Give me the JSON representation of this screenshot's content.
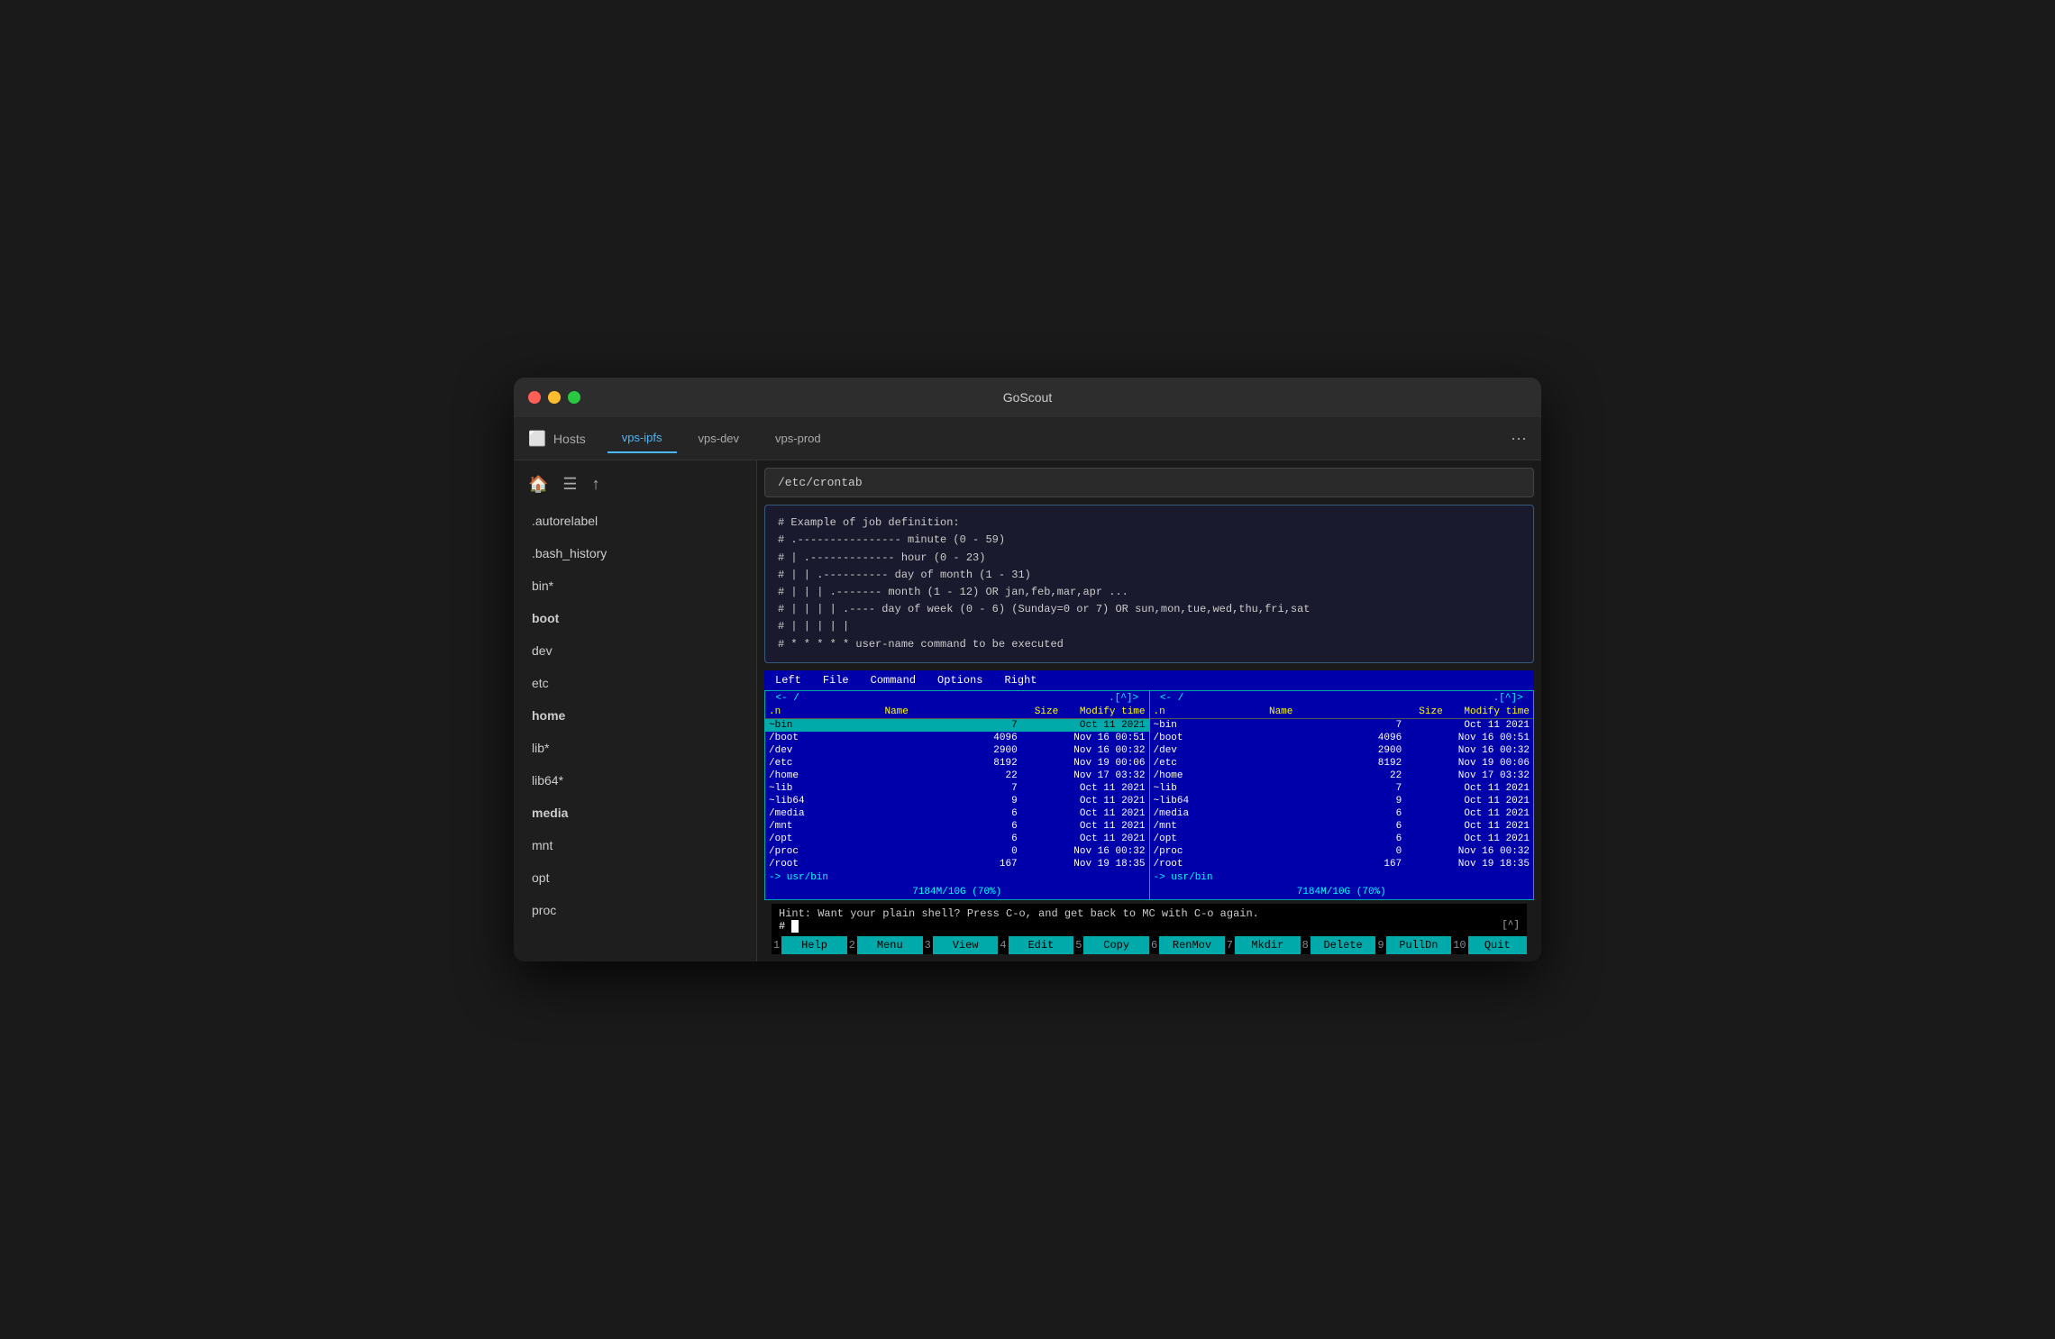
{
  "window": {
    "title": "GoScout"
  },
  "titlebar": {
    "title": "GoScout"
  },
  "tabs": {
    "hosts_label": "Hosts",
    "active_tab": "vps-ipfs",
    "items": [
      {
        "label": "vps-ipfs",
        "active": true
      },
      {
        "label": "vps-dev",
        "active": false
      },
      {
        "label": "vps-prod",
        "active": false
      }
    ]
  },
  "sidebar": {
    "items": [
      {
        "label": ".autorelabel",
        "bold": false
      },
      {
        "label": ".bash_history",
        "bold": false
      },
      {
        "label": "bin*",
        "bold": false
      },
      {
        "label": "boot",
        "bold": true
      },
      {
        "label": "dev",
        "bold": false
      },
      {
        "label": "etc",
        "bold": false
      },
      {
        "label": "home",
        "bold": true
      },
      {
        "label": "lib*",
        "bold": false
      },
      {
        "label": "lib64*",
        "bold": false
      },
      {
        "label": "media",
        "bold": true
      },
      {
        "label": "mnt",
        "bold": false
      },
      {
        "label": "opt",
        "bold": false
      },
      {
        "label": "proc",
        "bold": false
      }
    ]
  },
  "path_bar": {
    "value": "/etc/crontab"
  },
  "file_preview": {
    "lines": [
      "# Example of job definition:",
      "# .---------------- minute (0 - 59)",
      "# |  .------------- hour (0 - 23)",
      "# |  |  .---------- day of month (1 - 31)",
      "# |  |  |  .------- month (1 - 12) OR jan,feb,mar,apr ...",
      "# |  |  |  |  .---- day of week (0 - 6) (Sunday=0 or 7) OR sun,mon,tue,wed,thu,fri,sat",
      "# |  |  |  |  |",
      "# *  *  *  *  * user-name  command to be executed"
    ]
  },
  "mc": {
    "menubar": [
      "Left",
      "File",
      "Command",
      "Options",
      "Right"
    ],
    "left_panel": {
      "header": "<- /",
      "right_indicator": ".[^]>",
      "cols": [
        ".n",
        "Name",
        "Size",
        "Modify time"
      ],
      "files": [
        {
          "name": "~bin",
          "size": "7",
          "date": "Oct 11  2021",
          "selected": true
        },
        {
          "name": "/boot",
          "size": "4096",
          "date": "Nov 16 00:51"
        },
        {
          "name": "/dev",
          "size": "2900",
          "date": "Nov 16 00:32"
        },
        {
          "name": "/etc",
          "size": "8192",
          "date": "Nov 19 00:06"
        },
        {
          "name": "/home",
          "size": "22",
          "date": "Nov 17 03:32"
        },
        {
          "name": "~lib",
          "size": "7",
          "date": "Oct 11  2021"
        },
        {
          "name": "~lib64",
          "size": "9",
          "date": "Oct 11  2021"
        },
        {
          "name": "/media",
          "size": "6",
          "date": "Oct 11  2021"
        },
        {
          "name": "/mnt",
          "size": "6",
          "date": "Oct 11  2021"
        },
        {
          "name": "/opt",
          "size": "6",
          "date": "Oct 11  2021"
        },
        {
          "name": "/proc",
          "size": "0",
          "date": "Nov 16 00:32"
        },
        {
          "name": "/root",
          "size": "167",
          "date": "Nov 19 18:35"
        }
      ],
      "symlink": "-> usr/bin",
      "footer": "7184M/10G (70%)"
    },
    "right_panel": {
      "header": "<- /",
      "right_indicator": ".[^]>",
      "cols": [
        ".n",
        "Name",
        "Size",
        "Modify time"
      ],
      "files": [
        {
          "name": "~bin",
          "size": "7",
          "date": "Oct 11  2021"
        },
        {
          "name": "/boot",
          "size": "4096",
          "date": "Nov 16 00:51"
        },
        {
          "name": "/dev",
          "size": "2900",
          "date": "Nov 16 00:32"
        },
        {
          "name": "/etc",
          "size": "8192",
          "date": "Nov 19 00:06"
        },
        {
          "name": "/home",
          "size": "22",
          "date": "Nov 17 03:32"
        },
        {
          "name": "~lib",
          "size": "7",
          "date": "Oct 11  2021"
        },
        {
          "name": "~lib64",
          "size": "9",
          "date": "Oct 11  2021"
        },
        {
          "name": "/media",
          "size": "6",
          "date": "Oct 11  2021"
        },
        {
          "name": "/mnt",
          "size": "6",
          "date": "Oct 11  2021"
        },
        {
          "name": "/opt",
          "size": "6",
          "date": "Oct 11  2021"
        },
        {
          "name": "/proc",
          "size": "0",
          "date": "Nov 16 00:32"
        },
        {
          "name": "/root",
          "size": "167",
          "date": "Nov 19 18:35"
        }
      ],
      "symlink": "-> usr/bin",
      "footer": "7184M/10G (70%)"
    },
    "hint": "Hint: Want your plain shell? Press C-o, and get back to MC with C-o again.",
    "prompt": "#",
    "fkeys": [
      {
        "num": "1",
        "label": "Help"
      },
      {
        "num": "2",
        "label": "Menu"
      },
      {
        "num": "3",
        "label": "View"
      },
      {
        "num": "4",
        "label": "Edit"
      },
      {
        "num": "5",
        "label": "Copy"
      },
      {
        "num": "6",
        "label": "RenMov"
      },
      {
        "num": "7",
        "label": "Mkdir"
      },
      {
        "num": "8",
        "label": "Delete"
      },
      {
        "num": "9",
        "label": "PullDn"
      },
      {
        "num": "10",
        "label": "Quit"
      }
    ]
  }
}
